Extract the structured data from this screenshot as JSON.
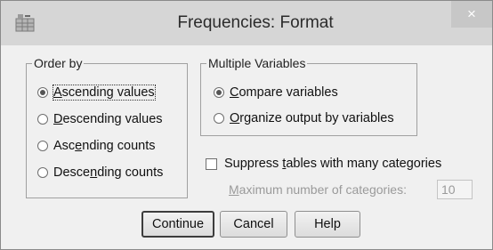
{
  "window": {
    "title": "Frequencies: Format",
    "close_glyph": "×",
    "app_icon": "spss-table-icon"
  },
  "order_by": {
    "legend": "Order by",
    "options": [
      {
        "pre": "",
        "accel": "A",
        "post": "scending values",
        "selected": true
      },
      {
        "pre": "",
        "accel": "D",
        "post": "escending values",
        "selected": false
      },
      {
        "pre": "Asc",
        "accel": "e",
        "post": "nding counts",
        "selected": false
      },
      {
        "pre": "Desce",
        "accel": "n",
        "post": "ding counts",
        "selected": false
      }
    ]
  },
  "multiple_variables": {
    "legend": "Multiple Variables",
    "options": [
      {
        "pre": "",
        "accel": "C",
        "post": "ompare variables",
        "selected": true
      },
      {
        "pre": "",
        "accel": "O",
        "post": "rganize output by variables",
        "selected": false
      }
    ]
  },
  "suppress": {
    "label_pre": "Suppress ",
    "label_accel": "t",
    "label_post": "ables with many categories",
    "checked": false,
    "max_pre": "",
    "max_accel": "M",
    "max_post": "aximum number of categories:",
    "max_value": "10"
  },
  "buttons": {
    "continue": "Continue",
    "cancel": "Cancel",
    "help": "Help"
  }
}
